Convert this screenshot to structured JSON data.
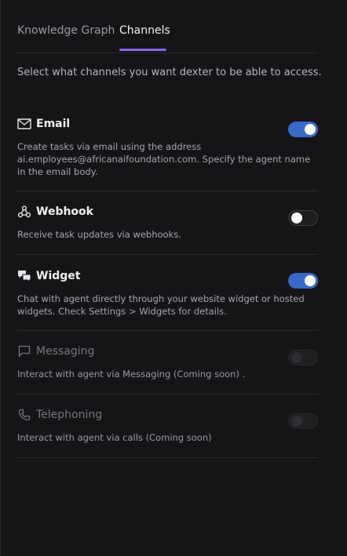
{
  "tabs": [
    {
      "label": "Knowledge Graph",
      "active": false
    },
    {
      "label": "Channels",
      "active": true
    }
  ],
  "intro": "Select what channels you want dexter to be able to access.",
  "channels": [
    {
      "title": "Email",
      "icon": "mail-icon",
      "description": "Create tasks via email using the address ai.employees@africanaifoundation.com. Specify the agent name in the email body.",
      "enabled": true
    },
    {
      "title": "Webhook",
      "icon": "webhook-icon",
      "description": "Receive task updates via webhooks.",
      "enabled": false
    },
    {
      "title": "Widget",
      "icon": "chat-bubbles-icon",
      "description": "Chat with agent directly through your website widget or hosted widgets. Check Settings > Widgets for details.",
      "enabled": true
    },
    {
      "title": "Messaging",
      "icon": "message-icon",
      "description": "Interact with agent via Messaging (Coming soon) .",
      "enabled": false,
      "disabled": true
    },
    {
      "title": "Telephoning",
      "icon": "phone-icon",
      "description": "Interact with agent via calls (Coming soon)",
      "enabled": false,
      "disabled": true
    }
  ],
  "colors": {
    "accent": "#8a63e8",
    "toggle_on": "#3b69c7",
    "background": "#151517"
  }
}
